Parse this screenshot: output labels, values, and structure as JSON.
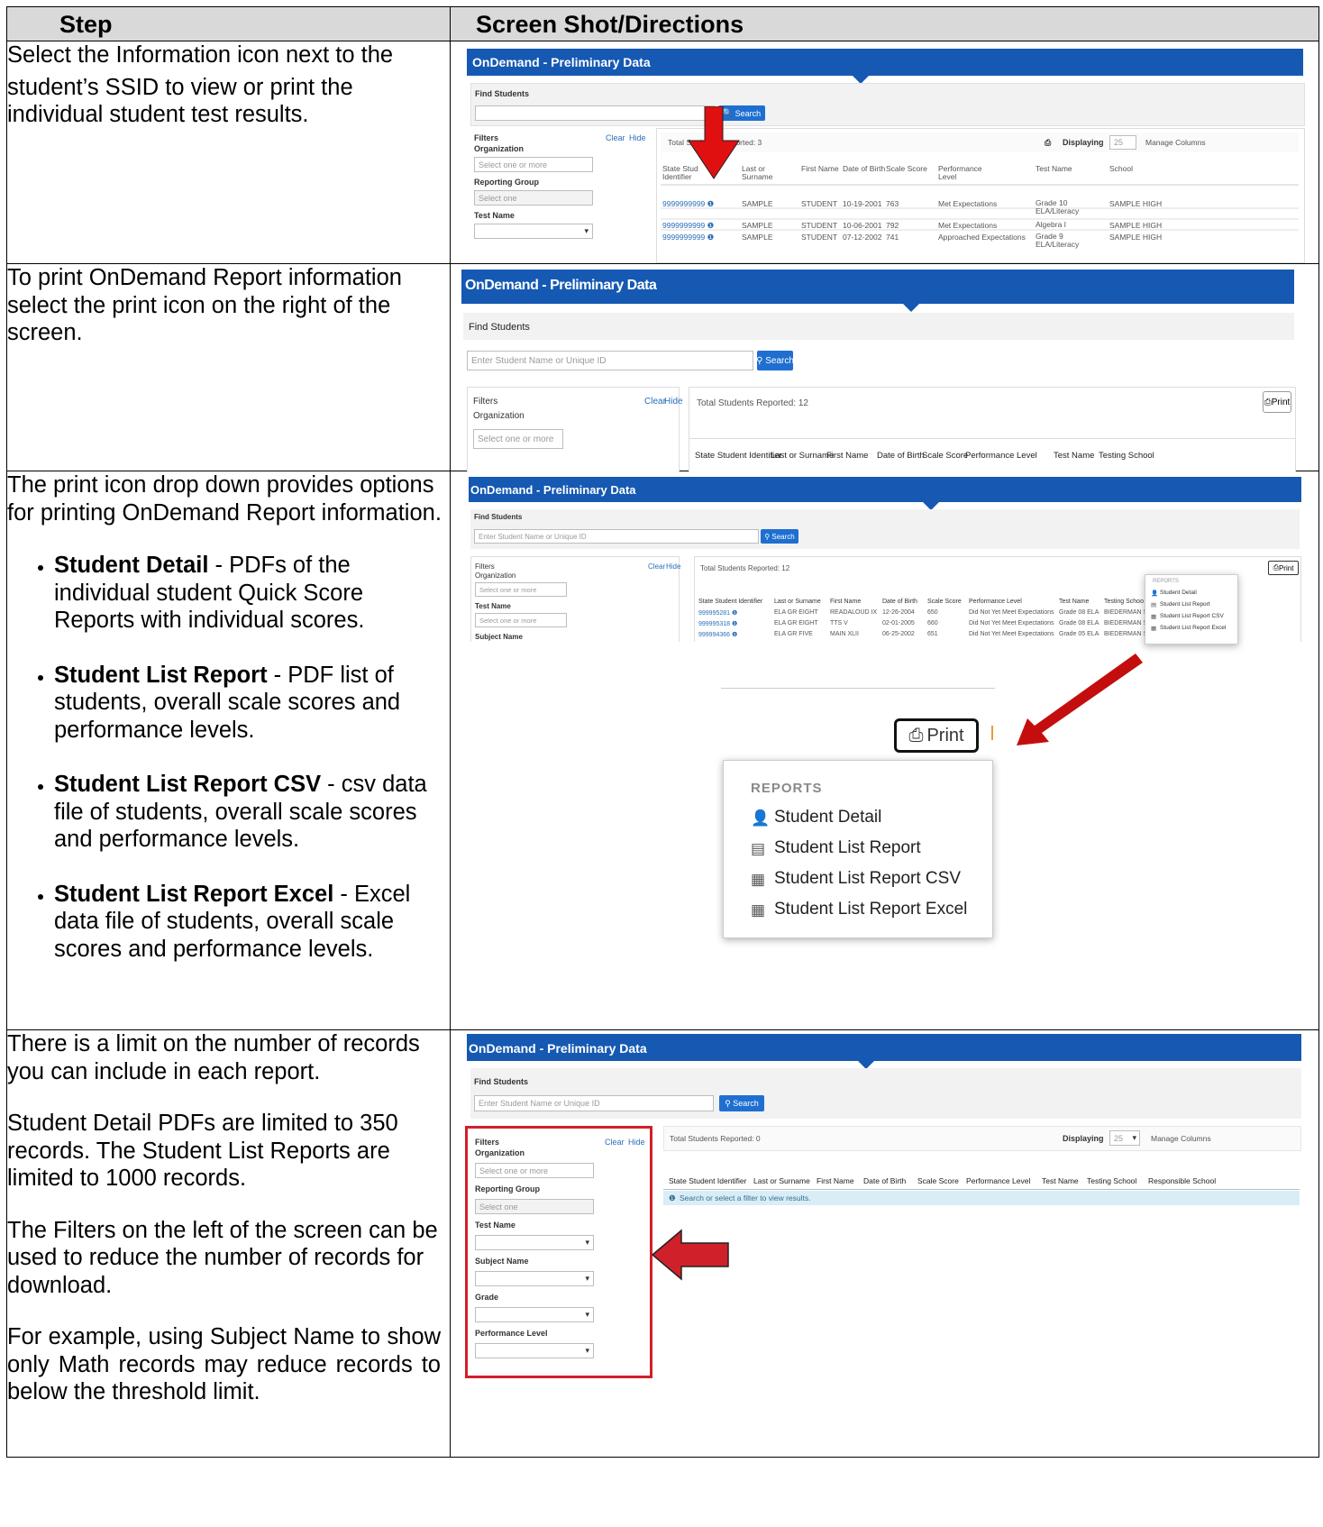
{
  "table": {
    "header_step": "Step",
    "header_shot": "Screen Shot/Directions"
  },
  "row1": {
    "text_line1": "Select the Information icon next to the",
    "text_line2": "student’s SSID to view or print the individual student test results.",
    "app_title": "OnDemand - Preliminary Data",
    "find_students": "Find Students",
    "search": "Search",
    "filters": "Filters",
    "organization": "Organization",
    "clear": "Clear",
    "hide": "Hide",
    "select_one_or_more": "Select one or more",
    "reporting_group": "Reporting Group",
    "select_one": "Select one",
    "test_name": "Test Name",
    "total_students": "Total Stud",
    "total_students_rest": "eported: 3",
    "displaying": "Displaying",
    "per_page": "25",
    "manage_columns": "Manage Columns",
    "columns": [
      "State Stud Identifier",
      "Last or Surname",
      "First Name",
      "Date of Birth",
      "Scale Score",
      "Performance Level",
      "Test Name",
      "School"
    ],
    "rows": [
      [
        "9999999999",
        "SAMPLE",
        "STUDENT",
        "10-19-2001",
        "763",
        "Met Expectations",
        "Grade 10 ELA/Literacy",
        "SAMPLE HIGH"
      ],
      [
        "9999999999",
        "SAMPLE",
        "STUDENT",
        "10-06-2001",
        "792",
        "Met Expectations",
        "Algebra I",
        "SAMPLE HIGH"
      ],
      [
        "9999999999",
        "SAMPLE",
        "STUDENT",
        "07-12-2002",
        "741",
        "Approached Expectations",
        "Grade 9 ELA/Literacy",
        "SAMPLE HIGH"
      ]
    ]
  },
  "row2": {
    "text": "To print OnDemand Report information select the print icon on the right of the screen.",
    "app_title": "OnDemand - Preliminary Data",
    "find_students": "Find Students",
    "search_placeholder": "Enter Student Name or Unique ID",
    "search": "Search",
    "filters": "Filters",
    "organization": "Organization",
    "clear": "Clear",
    "hide": "Hide",
    "select_one_or_more": "Select one or more",
    "total_students": "Total Students Reported: 12",
    "print": "Print",
    "columns": [
      "State Student Identifier",
      "Last or Surname",
      "First Name",
      "Date of Birth",
      "Scale Score",
      "Performance Level",
      "Test Name",
      "Testing School"
    ]
  },
  "row3": {
    "intro": "The print icon drop down provides options for printing OnDemand Report information.",
    "bullets": [
      {
        "bold": "Student Detail",
        "rest": " - PDFs of the individual student Quick Score Reports with individual scores."
      },
      {
        "bold": "Student List Report",
        "rest": " - PDF list of students, overall scale scores and performance levels."
      },
      {
        "bold": "Student List Report CSV",
        "rest": " - csv data file of students, overall scale scores and performance levels."
      },
      {
        "bold": "Student List Report Excel",
        "rest": " - Excel data file of students, overall scale scores and performance levels."
      }
    ],
    "app_title": "OnDemand - Preliminary Data",
    "find_students": "Find Students",
    "search_placeholder": "Enter Student Name or Unique ID",
    "search": "Search",
    "filters": "Filters",
    "organization": "Organization",
    "clear": "Clear",
    "hide": "Hide",
    "select_one_or_more": "Select one or more",
    "test_name": "Test Name",
    "subject_name": "Subject Name",
    "total_students": "Total Students Reported: 12",
    "print": "Print",
    "columns": [
      "State Student Identifier",
      "Last or Surname",
      "First Name",
      "Date of Birth",
      "Scale Score",
      "Performance Level",
      "Test Name",
      "Testing Schoo"
    ],
    "rows": [
      [
        "999995281",
        "ELA GR EIGHT",
        "READALOUD IX",
        "12-26-2004",
        "650",
        "Did Not Yet Meet Expectations",
        "Grade 08 ELA",
        "BIEDERMAN S"
      ],
      [
        "999995318",
        "ELA GR EIGHT",
        "TTS V",
        "02-01-2005",
        "660",
        "Did Not Yet Meet Expectations",
        "Grade 08 ELA",
        "BIEDERMAN S"
      ],
      [
        "999994366",
        "ELA GR FIVE",
        "MAIN XLII",
        "06-25-2002",
        "651",
        "Did Not Yet Meet Expectations",
        "Grade 05 ELA",
        "BIEDERMAN S"
      ]
    ],
    "reports_heading": "REPORTS",
    "menu": [
      "Student Detail",
      "Student List Report",
      "Student List Report CSV",
      "Student List Report Excel"
    ]
  },
  "row4": {
    "p1": "There is a limit on the number of records you can include in each report.",
    "p2": "Student Detail PDFs are limited to 350 records. The Student List Reports are limited to 1000 records.",
    "p3": "The Filters on the left of the screen can be used to reduce the number of records for download.",
    "p4": "For example, using Subject Name to show only Math records may reduce records to below the threshold limit.",
    "app_title": "OnDemand - Preliminary Data",
    "find_students": "Find Students",
    "search_placeholder": "Enter Student Name or Unique ID",
    "search": "Search",
    "filters": "Filters",
    "organization": "Organization",
    "clear": "Clear",
    "hide": "Hide",
    "select_one_or_more": "Select one or more",
    "reporting_group": "Reporting Group",
    "select_one": "Select one",
    "test_name": "Test Name",
    "subject_name": "Subject Name",
    "grade": "Grade",
    "performance_level": "Performance Level",
    "total_students": "Total Students Reported: 0",
    "displaying": "Displaying",
    "per_page": "25",
    "manage_columns": "Manage Columns",
    "columns": [
      "State Student Identifier",
      "Last or Surname",
      "First Name",
      "Date of Birth",
      "Scale Score",
      "Performance Level",
      "Test Name",
      "Testing School",
      "Responsible School"
    ],
    "info_message": "Search or select a filter to view results."
  },
  "colors": {
    "brand_blue": "#1559b2",
    "button_blue": "#1f6fd1",
    "arrow_red": "#e01010",
    "highlight_red": "#d0202a"
  }
}
